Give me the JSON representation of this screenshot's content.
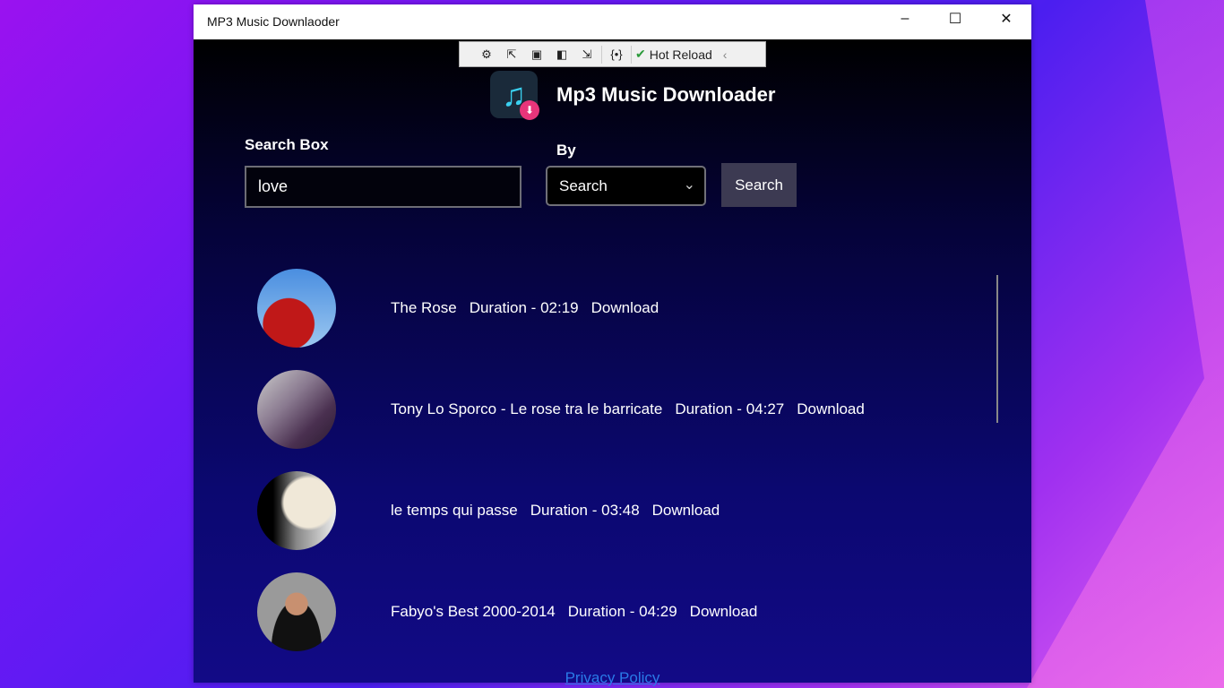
{
  "window": {
    "title": "MP3 Music Downlaoder"
  },
  "hot_reload": {
    "label": "Hot Reload"
  },
  "app": {
    "title": "Mp3 Music Downloader"
  },
  "search": {
    "label": "Search Box",
    "value": "love",
    "by_label": "By",
    "by_selected": "Search",
    "button": "Search"
  },
  "results": [
    {
      "title": "The Rose",
      "duration": "Duration - 02:19",
      "download": "Download"
    },
    {
      "title": "Tony Lo Sporco - Le rose tra le barricate",
      "duration": "Duration - 04:27",
      "download": "Download"
    },
    {
      "title": "le temps qui passe",
      "duration": "Duration - 03:48",
      "download": "Download"
    },
    {
      "title": "Fabyo's Best 2000-2014",
      "duration": "Duration - 04:29",
      "download": "Download"
    }
  ],
  "footer": {
    "privacy": "Privacy Policy"
  }
}
